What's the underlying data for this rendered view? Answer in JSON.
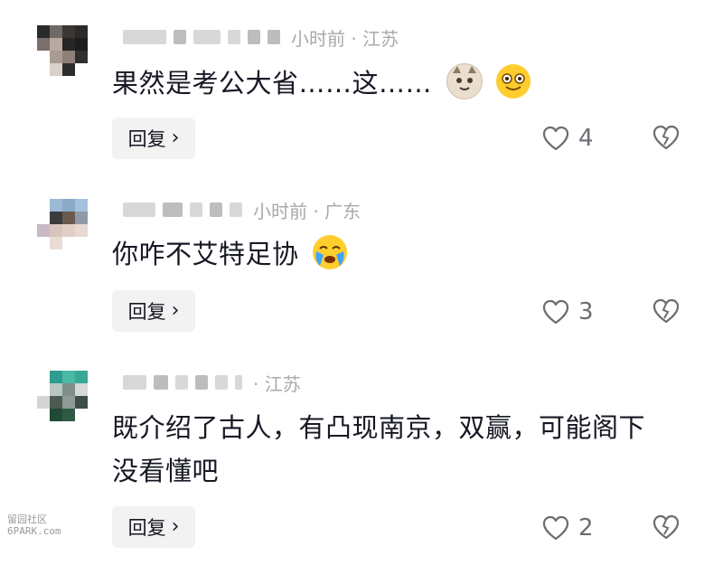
{
  "comments": [
    {
      "location": "小时前 · 江苏",
      "text": "果然是考公大省……这……",
      "reply_label": "回复",
      "likes": "4",
      "emojis": [
        "cat-face-emoji",
        "grinning-face-emoji"
      ]
    },
    {
      "location": "小时前 · 广东",
      "text": "你咋不艾特足协",
      "reply_label": "回复",
      "likes": "3",
      "emojis": [
        "crying-face-emoji"
      ]
    },
    {
      "location": "· 江苏",
      "text_line1": "既介绍了古人，有凸现南京，双赢，可能阁下",
      "text_line2": "没看懂吧",
      "reply_label": "回复",
      "likes": "2",
      "emojis": []
    }
  ],
  "watermark": {
    "line1": "留园社区",
    "line2": "6PARK.com"
  },
  "colors": {
    "text": "#161823",
    "meta": "#a7a9ad",
    "reply_bg": "#f2f2f2",
    "icon": "#6b6d72"
  }
}
